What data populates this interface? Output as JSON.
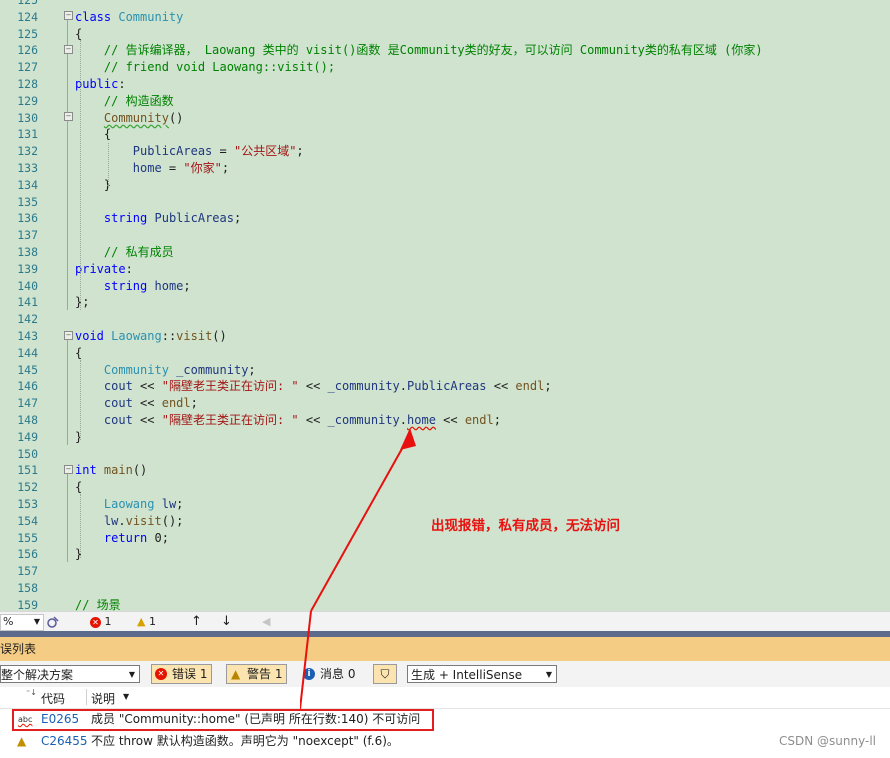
{
  "editor": {
    "lines": [
      {
        "n": "125",
        "html": ""
      },
      {
        "n": "124",
        "html": "<span class='kw'>class</span> <span class='ty'>Community</span>"
      },
      {
        "n": "125",
        "html": "{"
      },
      {
        "n": "126",
        "html": "    <span class='cm'>// 告诉编译器， Laowang 类中的 visit()函数 是Community类的好友，可以访问 Community类的私有区域 (你家)</span>"
      },
      {
        "n": "127",
        "html": "    <span class='cm'>// friend void Laowang::visit();</span>"
      },
      {
        "n": "128",
        "html": "<span class='kw'>public</span>:"
      },
      {
        "n": "129",
        "html": "    <span class='cm'>// 构造函数</span>"
      },
      {
        "n": "130",
        "html": "    <span class='fn squig-green'>Community</span>()"
      },
      {
        "n": "131",
        "html": "    {"
      },
      {
        "n": "132",
        "html": "        <span class='var'>PublicAreas</span> = <span class='str'>\"公共区域\"</span>;"
      },
      {
        "n": "133",
        "html": "        <span class='var'>home</span> = <span class='str'>\"你家\"</span>;"
      },
      {
        "n": "134",
        "html": "    }"
      },
      {
        "n": "135",
        "html": ""
      },
      {
        "n": "136",
        "html": "    <span class='kw'>string</span> <span class='var'>PublicAreas</span>;"
      },
      {
        "n": "137",
        "html": ""
      },
      {
        "n": "138",
        "html": "    <span class='cm'>// 私有成员</span>"
      },
      {
        "n": "139",
        "html": "<span class='kw'>private</span>:"
      },
      {
        "n": "140",
        "html": "    <span class='kw'>string</span> <span class='var'>home</span>;"
      },
      {
        "n": "141",
        "html": "};"
      },
      {
        "n": "142",
        "html": ""
      },
      {
        "n": "143",
        "html": "<span class='kw'>void</span> <span class='ty'>Laowang</span>::<span class='fn'>visit</span>()"
      },
      {
        "n": "144",
        "html": "{"
      },
      {
        "n": "145",
        "html": "    <span class='ty'>Community</span> <span class='var'>_community</span>;"
      },
      {
        "n": "146",
        "html": "    <span class='var'>cout</span> &lt;&lt; <span class='str'>\"隔壁老王类正在访问: \"</span> &lt;&lt; <span class='var'>_community</span>.<span class='var'>PublicAreas</span> &lt;&lt; <span class='fn'>endl</span>;"
      },
      {
        "n": "147",
        "html": "    <span class='var'>cout</span> &lt;&lt; <span class='fn'>endl</span>;"
      },
      {
        "n": "148",
        "html": "    <span class='var'>cout</span> &lt;&lt; <span class='str'>\"隔壁老王类正在访问: \"</span> &lt;&lt; <span class='var'>_community</span>.<span class='var squig-red'>home</span> &lt;&lt; <span class='fn'>endl</span>;"
      },
      {
        "n": "149",
        "html": "}"
      },
      {
        "n": "150",
        "html": ""
      },
      {
        "n": "151",
        "html": "<span class='kw'>int</span> <span class='fn'>main</span>()"
      },
      {
        "n": "152",
        "html": "{"
      },
      {
        "n": "153",
        "html": "    <span class='ty'>Laowang</span> <span class='var'>lw</span>;"
      },
      {
        "n": "154",
        "html": "    <span class='var'>lw</span>.<span class='fn'>visit</span>();"
      },
      {
        "n": "155",
        "html": "    <span class='kw'>return</span> 0;"
      },
      {
        "n": "156",
        "html": "}"
      },
      {
        "n": "157",
        "html": ""
      },
      {
        "n": "158",
        "html": ""
      },
      {
        "n": "159",
        "html": "<span class='cm'>// 场景</span>"
      }
    ]
  },
  "statusbar": {
    "zoom": "%",
    "errors": "1",
    "warnings": "1"
  },
  "annotation": {
    "text": "出现报错，私有成员，无法访问"
  },
  "error_list": {
    "title": "误列表",
    "scope": "整个解决方案",
    "errors_btn": "错误 1",
    "warnings_btn": "警告 1",
    "messages_btn": "消息 0",
    "build_filter": "生成 + IntelliSense",
    "columns": {
      "code": "代码",
      "desc": "说明"
    },
    "rows": [
      {
        "icon_text": "abc",
        "code": "E0265",
        "desc": "成员 \"Community::home\" (已声明 所在行数:140) 不可访问"
      },
      {
        "code": "C26455",
        "desc": "不应 throw 默认构造函数。声明它为 \"noexcept\" (f.6)。"
      }
    ]
  },
  "watermark": "CSDN @sunny-ll",
  "colors": {
    "editor_bg": "#cfe3cf",
    "annotation": "#e8110f",
    "panel_title_bg": "#f5cc84"
  }
}
